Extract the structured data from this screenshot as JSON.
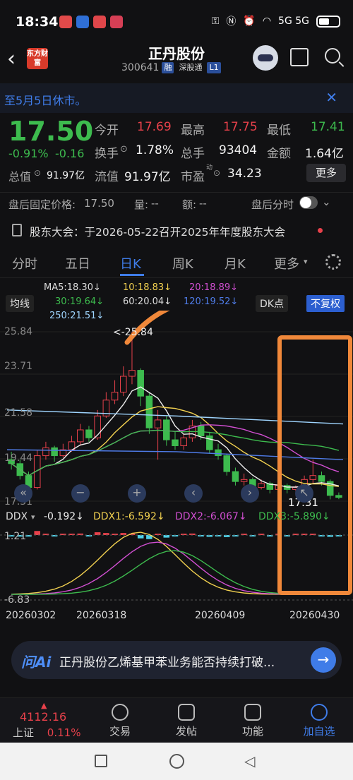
{
  "status": {
    "time": "18:34",
    "icons": "5G 5G"
  },
  "header": {
    "back": "‹",
    "logo_text": "东方财富",
    "title": "正丹股份",
    "code": "300641",
    "tag1": "融",
    "tag2": "深股通",
    "tag3": "L1"
  },
  "notice": {
    "text": "至5月5日休市。",
    "close": "✕"
  },
  "quote": {
    "price": "17.50",
    "change_pct": "-0.91%",
    "change": "-0.16",
    "open_label": "今开",
    "open": "17.69",
    "high_label": "最高",
    "high": "17.75",
    "low_label": "最低",
    "low": "17.41",
    "turnover_label": "换手",
    "turnover": "1.78%",
    "volume_label": "总手",
    "volume": "93404",
    "amount_label": "金额",
    "amount": "1.64亿",
    "mktcap_label": "总值",
    "mktcap": "91.97亿",
    "float_label": "流值",
    "float": "91.97亿",
    "pe_label": "市盈",
    "pe_sup": "动",
    "pe": "34.23",
    "more": "更多"
  },
  "after_hours": {
    "price_label": "盘后固定价格:",
    "price": "17.50",
    "vol_label": "量:",
    "vol": "--",
    "amt_label": "额:",
    "amt": "--",
    "toggle_label": "盘后分时"
  },
  "meeting": {
    "text": "股东大会：于2026-05-22召开2025年年度股东大会"
  },
  "tabs": [
    "分时",
    "五日",
    "日K",
    "周K",
    "月K",
    "更多"
  ],
  "ma": {
    "ma5": "MA5:18.30↓",
    "ma10": "10:18.83↓",
    "ma20": "20:18.89↓",
    "ma30": "30:19.64↓",
    "ma60": "60:20.04↓",
    "ma120": "120:19.52↓",
    "ma250": "250:21.51↓",
    "mode": "均线",
    "dk": "DK点",
    "fq": "不复权"
  },
  "chart_data": {
    "type": "candlestick",
    "y_ticks": [
      "25.84",
      "23.71",
      "21.58",
      "19.44",
      "17.31"
    ],
    "high_marker": "<-25.84",
    "last_marker": "17.31",
    "ylim": [
      17.31,
      25.84
    ],
    "candles": [
      [
        19.4,
        19.2,
        19.8,
        18.9
      ],
      [
        19.2,
        18.6,
        19.4,
        18.4
      ],
      [
        18.6,
        18.0,
        18.8,
        17.6
      ],
      [
        18.0,
        19.6,
        19.9,
        17.9
      ],
      [
        19.6,
        20.0,
        20.3,
        19.4
      ],
      [
        20.0,
        19.6,
        20.1,
        19.3
      ],
      [
        19.6,
        19.9,
        20.2,
        19.5
      ],
      [
        19.9,
        20.3,
        20.6,
        19.8
      ],
      [
        20.3,
        20.9,
        21.2,
        20.1
      ],
      [
        20.9,
        20.5,
        21.1,
        20.3
      ],
      [
        20.5,
        21.6,
        21.9,
        20.4
      ],
      [
        21.6,
        22.4,
        22.8,
        21.5
      ],
      [
        22.4,
        22.8,
        23.4,
        22.2
      ],
      [
        22.8,
        23.6,
        24.1,
        22.6
      ],
      [
        23.6,
        23.9,
        25.84,
        23.2
      ],
      [
        23.9,
        22.6,
        24.0,
        22.1
      ],
      [
        22.6,
        21.0,
        22.8,
        20.7
      ],
      [
        21.0,
        21.4,
        21.9,
        19.4
      ],
      [
        21.4,
        20.4,
        21.6,
        20.1
      ],
      [
        20.4,
        20.1,
        20.8,
        19.9
      ],
      [
        20.1,
        20.5,
        20.7,
        19.9
      ],
      [
        20.5,
        21.1,
        21.4,
        20.3
      ],
      [
        21.1,
        20.6,
        21.3,
        20.4
      ],
      [
        20.6,
        19.9,
        20.8,
        19.7
      ],
      [
        19.9,
        19.6,
        20.2,
        19.4
      ],
      [
        19.6,
        18.8,
        19.7,
        18.6
      ],
      [
        18.8,
        18.3,
        19.0,
        18.1
      ],
      [
        18.3,
        18.4,
        18.7,
        18.1
      ],
      [
        18.4,
        18.0,
        18.5,
        17.8
      ],
      [
        18.0,
        18.2,
        18.4,
        17.9
      ],
      [
        18.2,
        17.9,
        18.3,
        17.7
      ],
      [
        17.9,
        18.1,
        18.2,
        17.8
      ],
      [
        18.1,
        17.9,
        18.2,
        17.7
      ],
      [
        17.9,
        18.0,
        18.1,
        17.8
      ],
      [
        18.0,
        18.4,
        18.6,
        17.9
      ],
      [
        18.4,
        18.6,
        19.4,
        18.2
      ],
      [
        18.6,
        18.3,
        18.8,
        18.1
      ],
      [
        18.3,
        17.6,
        18.4,
        17.4
      ],
      [
        17.6,
        17.5,
        17.75,
        17.41
      ]
    ],
    "ddx_label": "DDX",
    "ddx": "-0.192↓",
    "ddx1": "DDX1:-6.592↓",
    "ddx2": "DDX2:-6.067↓",
    "ddx3": "DDX3:-5.890↓",
    "ddx_top": "1.21",
    "ddx_bottom": "-6.83",
    "dates": [
      "20260302",
      "20260318",
      "20260409",
      "20260430"
    ]
  },
  "ai": {
    "logo": "问Ai",
    "text": "正丹股份乙烯基甲苯业务能否持续打破..."
  },
  "bottom": {
    "index_value": "4112.16",
    "index_name": "上证",
    "index_pct": "0.11%",
    "trade": "交易",
    "post": "发帖",
    "func": "功能",
    "add": "加自选"
  },
  "colors": {
    "up": "#e8414b",
    "down": "#3dbb4e",
    "accent": "#3f7ce8",
    "annot": "#f0883a"
  }
}
